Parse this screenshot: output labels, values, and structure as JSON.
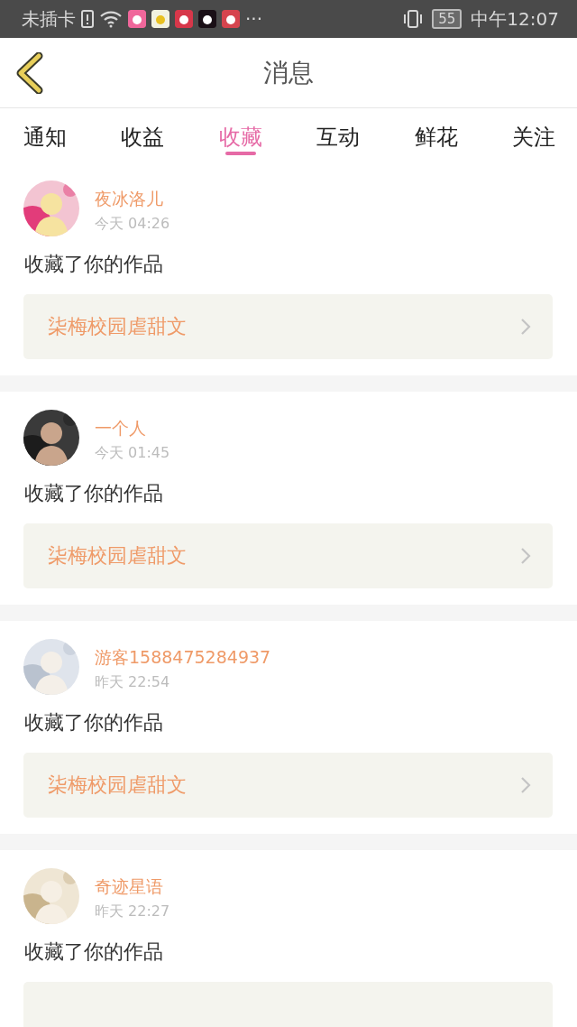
{
  "status_bar": {
    "carrier": "未插卡",
    "overflow": "···",
    "battery": "55",
    "time": "中午12:07"
  },
  "header": {
    "title": "消息"
  },
  "tabs": [
    {
      "label": "通知",
      "selected": false
    },
    {
      "label": "收益",
      "selected": false
    },
    {
      "label": "收藏",
      "selected": true
    },
    {
      "label": "互动",
      "selected": false
    },
    {
      "label": "鲜花",
      "selected": false
    },
    {
      "label": "关注",
      "selected": false
    }
  ],
  "messages": [
    {
      "name": "夜冰洛儿",
      "time": "今天 04:26",
      "text": "收藏了你的作品",
      "work": "柒梅校园虐甜文"
    },
    {
      "name": "一个人",
      "time": "今天 01:45",
      "text": "收藏了你的作品",
      "work": "柒梅校园虐甜文"
    },
    {
      "name": "游客1588475284937",
      "time": "昨天 22:54",
      "text": "收藏了你的作品",
      "work": "柒梅校园虐甜文"
    },
    {
      "name": "奇迹星语",
      "time": "昨天 22:27",
      "text": "收藏了你的作品"
    }
  ]
}
